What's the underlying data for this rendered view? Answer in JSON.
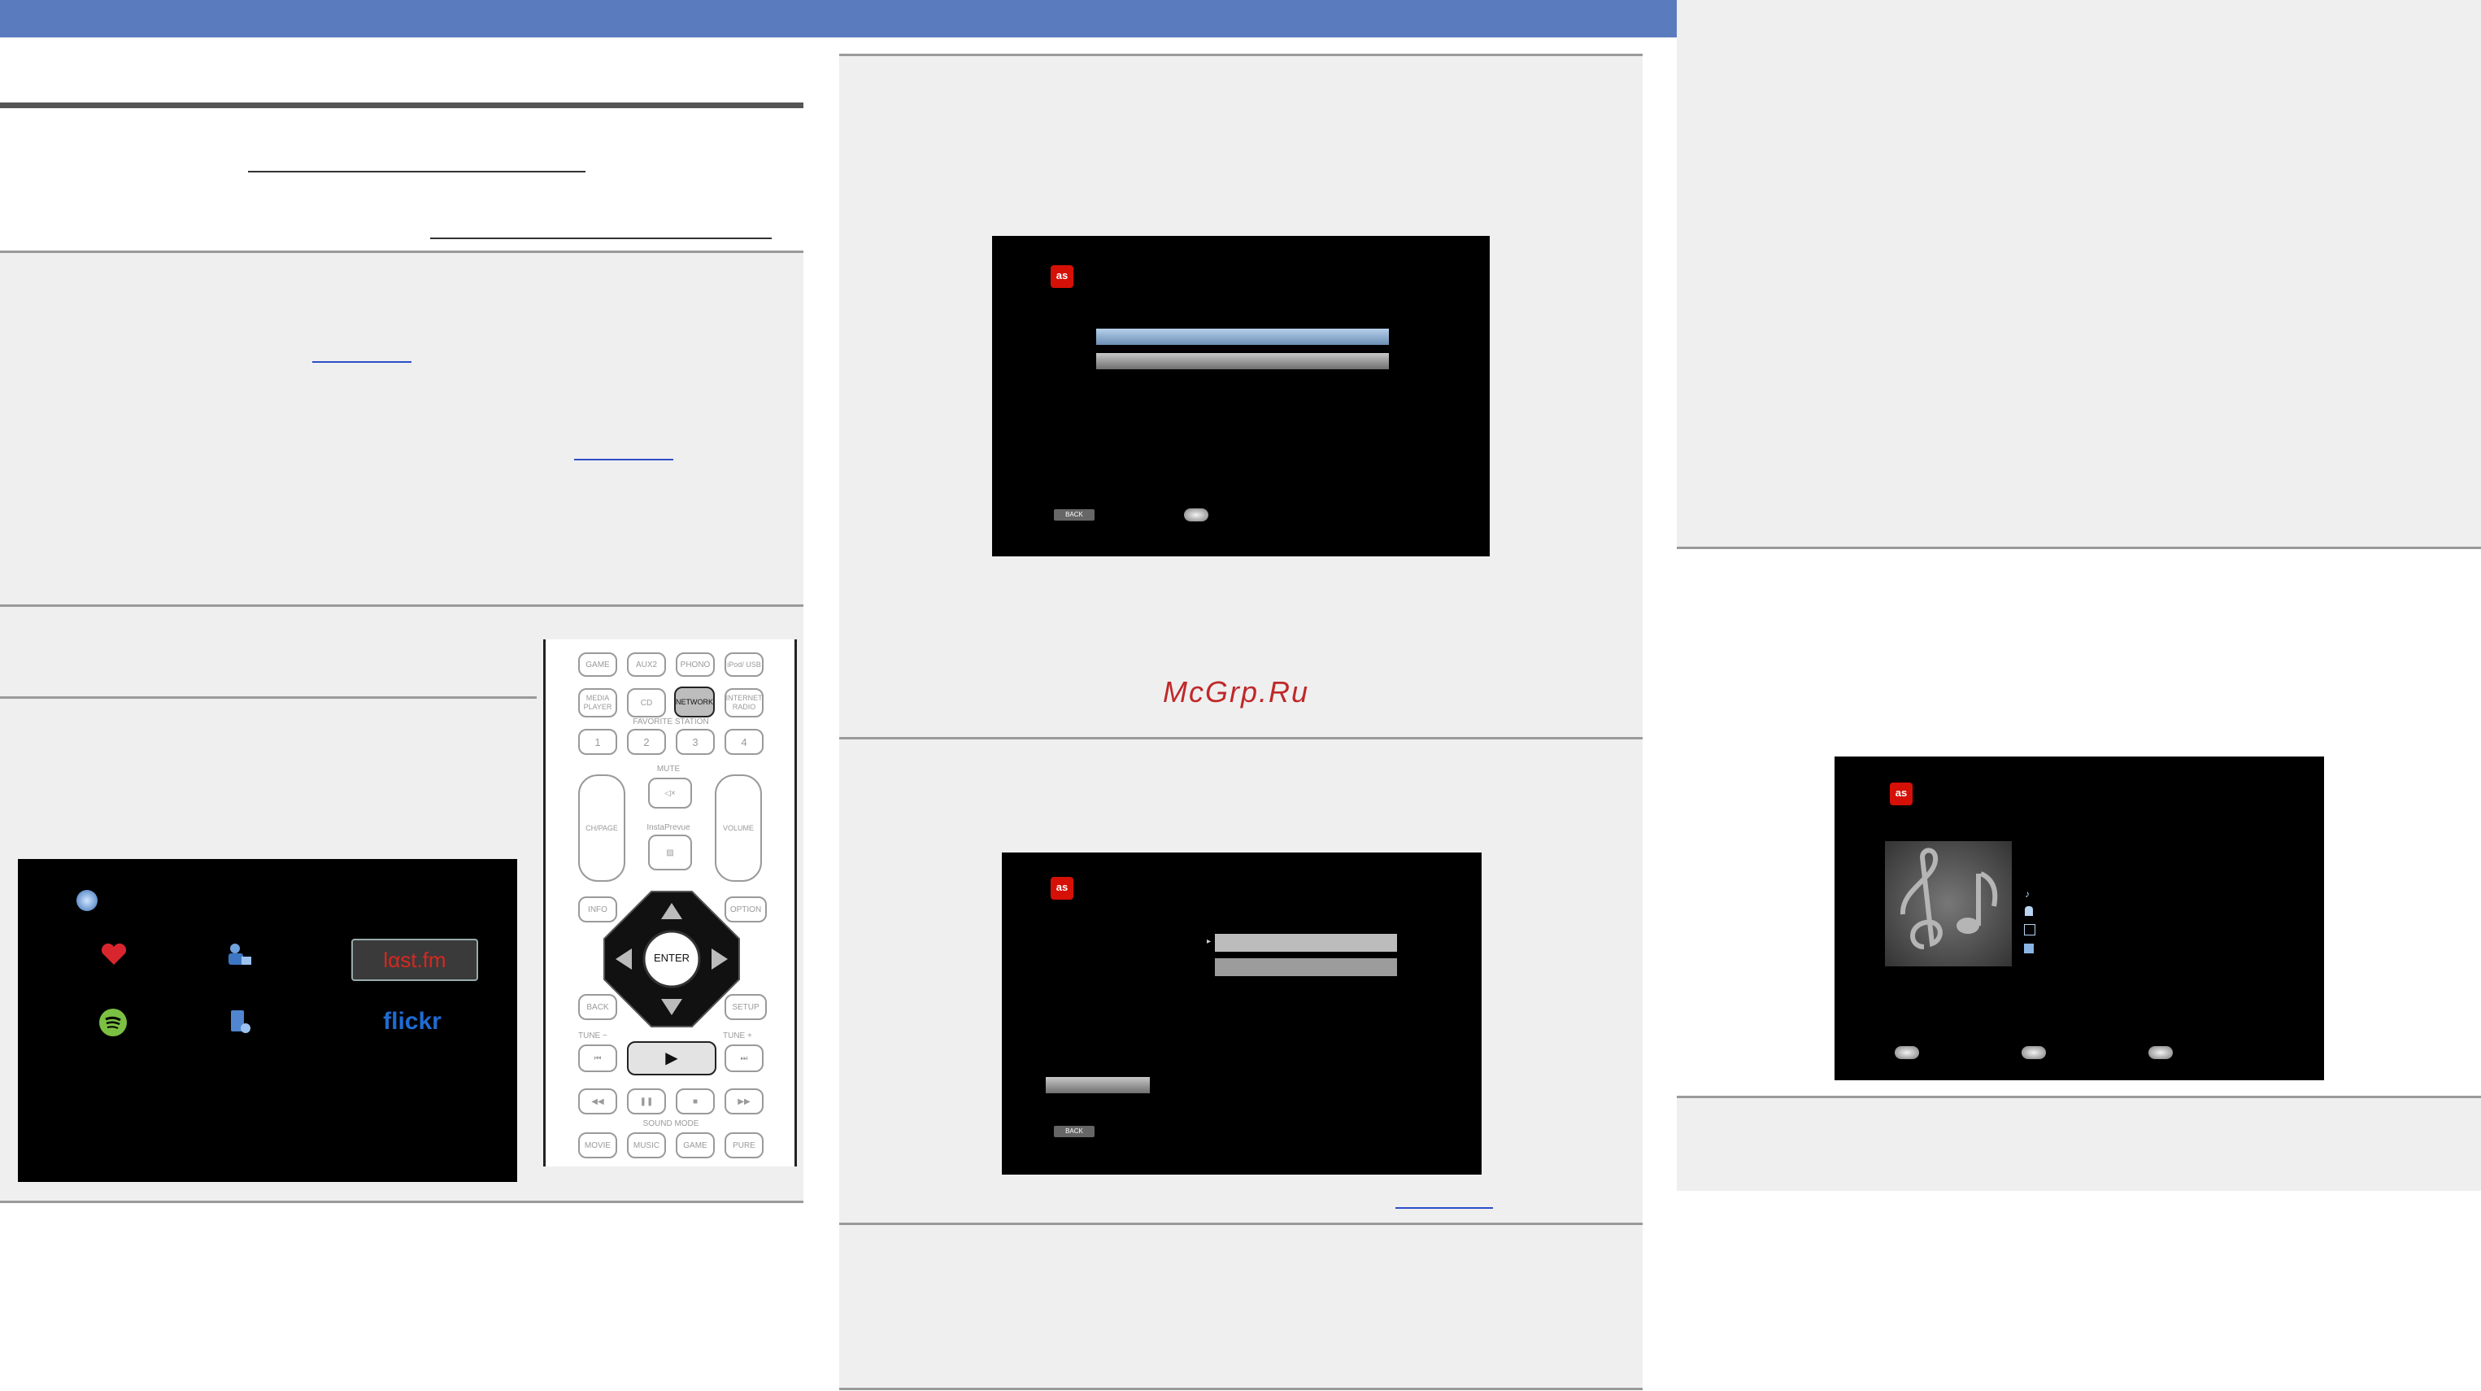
{
  "header": {
    "color": "#5b7bbf"
  },
  "left_column": {
    "remote": {
      "row1": [
        "GAME",
        "AUX2",
        "PHONO",
        "iPod/ USB"
      ],
      "row2": [
        "MEDIA PLAYER",
        "CD",
        "NETWORK",
        "INTERNET RADIO"
      ],
      "favorite_label": "FAVORITE STATION",
      "number_keys": [
        "1",
        "2",
        "3",
        "4"
      ],
      "ch_page": "CH/PAGE",
      "mute": "MUTE",
      "volume": "VOLUME",
      "instaprevue": "InstaPrevue",
      "info": "INFO",
      "option": "OPTION",
      "enter": "ENTER",
      "back": "BACK",
      "setup": "SETUP",
      "tune_minus": "TUNE −",
      "tune_plus": "TUNE +",
      "sound_mode": "SOUND MODE",
      "mode_keys": [
        "MOVIE",
        "MUSIC",
        "GAME",
        "PURE"
      ]
    },
    "network_screen": {
      "services": [
        "lαst.fm",
        "flickr"
      ]
    }
  },
  "middle_column": {
    "screen1_back": "BACK",
    "screen2_back": "BACK",
    "watermark": "McGrp.Ru"
  }
}
